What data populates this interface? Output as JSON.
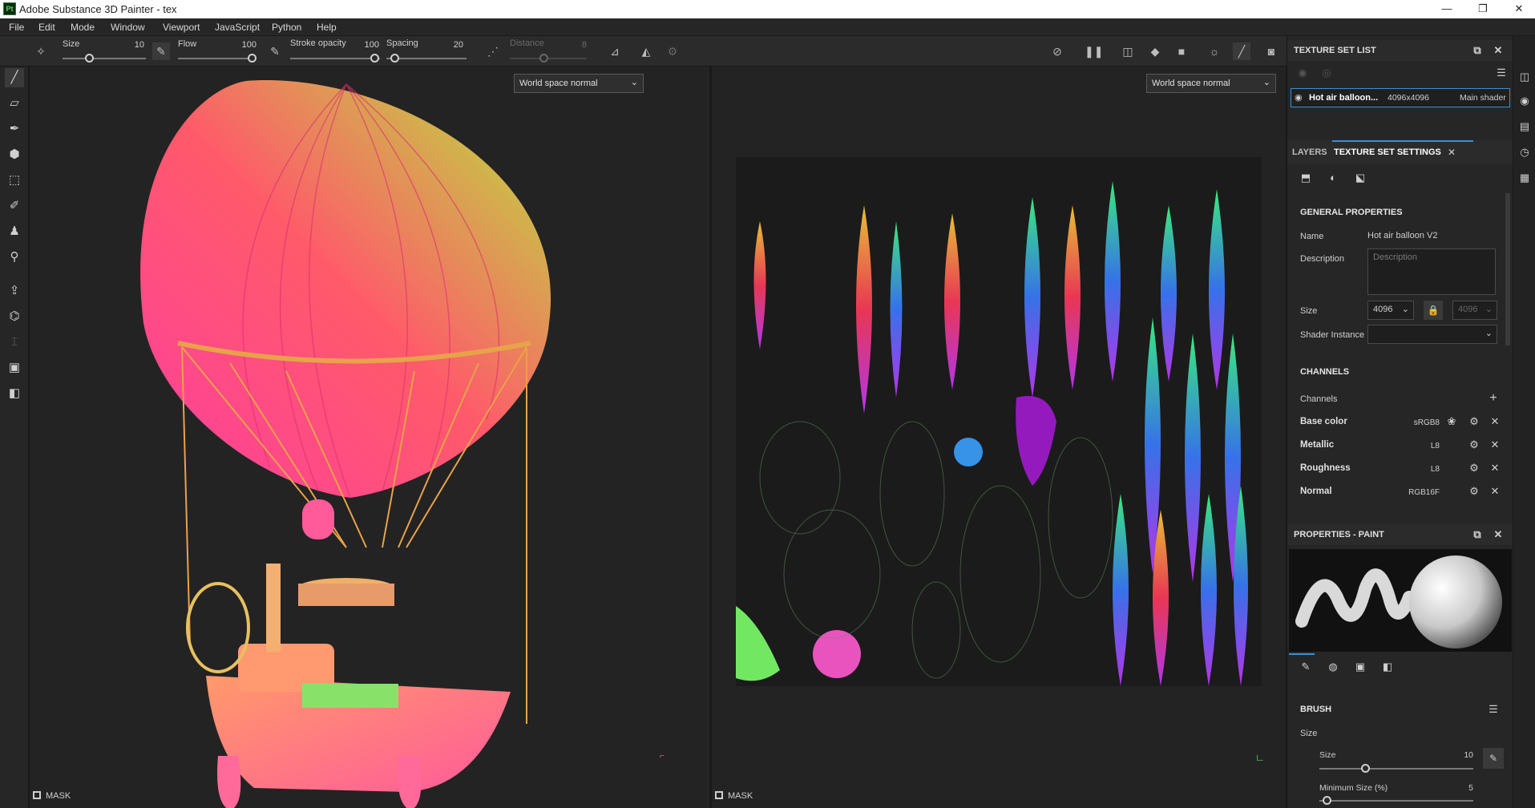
{
  "window": {
    "title": "Adobe Substance 3D Painter - tex",
    "logo_text": "Pt",
    "minimize": "—",
    "maximize": "❐",
    "close": "✕"
  },
  "menu": [
    "File",
    "Edit",
    "Mode",
    "Window",
    "Viewport",
    "JavaScript",
    "Python",
    "Help"
  ],
  "toolbar": {
    "size_label": "Size",
    "size_value": "10",
    "flow_label": "Flow",
    "flow_value": "100",
    "opacity_label": "Stroke opacity",
    "opacity_value": "100",
    "spacing_label": "Spacing",
    "spacing_value": "20",
    "distance_label": "Distance",
    "distance_value": "8"
  },
  "viewport3d": {
    "mode": "World space normal",
    "mask_label": "MASK"
  },
  "viewport2d": {
    "mode": "World space normal",
    "mask_label": "MASK"
  },
  "texture_set_list": {
    "title": "TEXTURE SET LIST",
    "item_name": "Hot air balloon...",
    "item_resolution": "4096x4096",
    "item_shader": "Main shader"
  },
  "tabs": {
    "layers": "LAYERS",
    "texture_set_settings": "TEXTURE SET SETTINGS"
  },
  "general": {
    "heading": "GENERAL PROPERTIES",
    "name_label": "Name",
    "name_value": "Hot air balloon V2",
    "description_label": "Description",
    "description_placeholder": "Description",
    "size_label": "Size",
    "size_value": "4096",
    "size_value_locked": "4096",
    "shader_label": "Shader Instance",
    "shader_value": ""
  },
  "channels": {
    "heading": "CHANNELS",
    "label": "Channels",
    "items": [
      {
        "name": "Base color",
        "format": "sRGB8"
      },
      {
        "name": "Metallic",
        "format": "L8"
      },
      {
        "name": "Roughness",
        "format": "L8"
      },
      {
        "name": "Normal",
        "format": "RGB16F"
      }
    ]
  },
  "properties": {
    "title": "PROPERTIES - PAINT",
    "brush_heading": "BRUSH",
    "size_section": "Size",
    "size_label": "Size",
    "size_value": "10",
    "size_fraction": 0.3,
    "min_size_label": "Minimum Size (%)",
    "min_size_value": "5",
    "min_size_fraction": 0.05
  },
  "colors": {
    "accent": "#3a8fd6",
    "panel": "#262626",
    "viewport": "#232323"
  }
}
